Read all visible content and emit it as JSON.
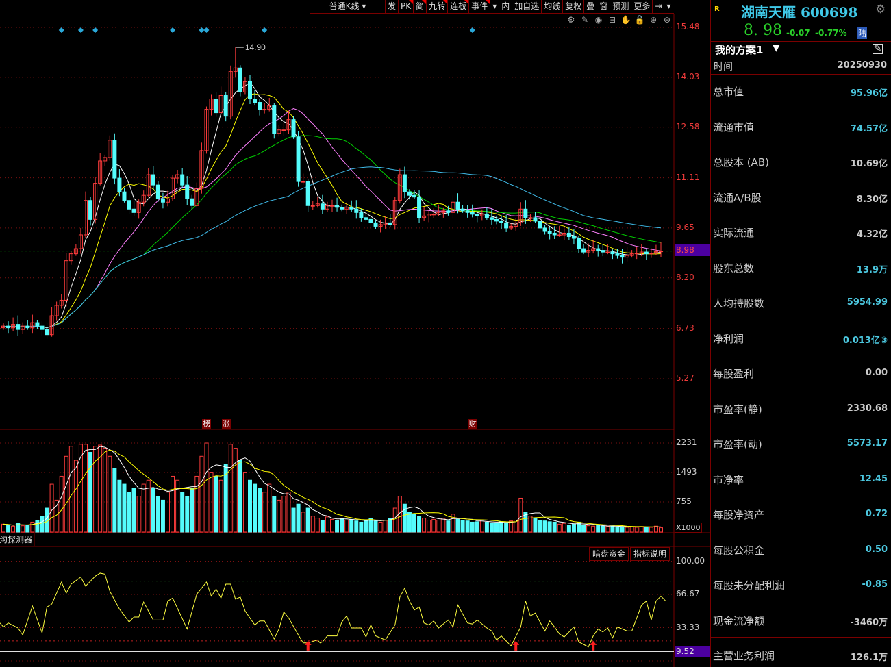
{
  "toolbar": {
    "items": [
      {
        "label": "普通K线 ▾",
        "flag": false
      },
      {
        "label": "发",
        "flag": false
      },
      {
        "label": "PK",
        "flag": true
      },
      {
        "label": "简",
        "flag": true
      },
      {
        "label": "九转",
        "flag": true
      },
      {
        "label": "连板",
        "flag": true
      },
      {
        "label": "事件",
        "flag": true
      },
      {
        "label": "▾",
        "flag": false
      },
      {
        "label": "内",
        "flag": false
      },
      {
        "label": "加自选",
        "flag": false
      },
      {
        "label": "均线",
        "flag": false
      },
      {
        "label": "复权",
        "flag": false
      },
      {
        "label": "叠",
        "flag": false
      },
      {
        "label": "窗",
        "flag": false
      },
      {
        "label": "预测",
        "flag": false
      },
      {
        "label": "更多",
        "flag": false
      },
      {
        "label": "⇥",
        "flag": false
      },
      {
        "label": "▾",
        "flag": false
      }
    ],
    "tools": [
      {
        "name": "settings-icon",
        "glyph": "⚙"
      },
      {
        "name": "pen-icon",
        "glyph": "✎"
      },
      {
        "name": "eye-icon",
        "glyph": "◉"
      },
      {
        "name": "basket-icon",
        "glyph": "⊟"
      },
      {
        "name": "hand-icon",
        "glyph": "✋"
      },
      {
        "name": "lock-icon",
        "glyph": "🔓"
      },
      {
        "name": "zoom-in-icon",
        "glyph": "⊕"
      },
      {
        "name": "zoom-out-icon",
        "glyph": "⊖"
      }
    ]
  },
  "price_axis": {
    "labels": [
      "15.48",
      "14.03",
      "12.58",
      "11.11",
      "9.65",
      "8.20",
      "6.73",
      "5.27"
    ],
    "max": 15.48,
    "min": 5.27,
    "current": "8.98",
    "current_value": 8.98,
    "high_label": "14.90",
    "high_value": 14.9
  },
  "colors": {
    "up": "#ff3c3c",
    "down": "#54fcfc",
    "ma5": "#ffffff",
    "ma10": "#ffff00",
    "ma20": "#ff80ff",
    "ma30": "#00d000",
    "ma60": "#40bcea",
    "grid": "#7a1010",
    "current_line": "#00c000",
    "osc": "#ffff40",
    "event_diamond": "#2aa8d8"
  },
  "ma_periods": [
    5,
    10,
    20,
    30,
    60
  ],
  "closes": [
    6.8,
    6.75,
    6.85,
    6.7,
    6.8,
    6.75,
    6.9,
    6.8,
    6.7,
    6.55,
    7.1,
    7.4,
    7.55,
    8.7,
    8.9,
    9.05,
    9.45,
    10.45,
    9.9,
    10.95,
    11.6,
    11.7,
    12.2,
    11.1,
    10.7,
    10.45,
    10.2,
    10.1,
    10.4,
    10.6,
    11.2,
    10.9,
    10.5,
    10.4,
    10.5,
    11.1,
    11.2,
    10.9,
    10.5,
    10.3,
    10.8,
    11.9,
    13.1,
    13.4,
    13.0,
    13.5,
    12.9,
    14.2,
    14.3,
    13.6,
    13.9,
    13.4,
    13.3,
    13.1,
    13.1,
    13.2,
    12.4,
    12.5,
    12.5,
    12.8,
    12.3,
    11.0,
    11.0,
    10.3,
    10.3,
    10.35,
    10.2,
    10.3,
    10.3,
    10.25,
    10.2,
    10.25,
    10.2,
    10.1,
    9.95,
    9.9,
    9.8,
    9.7,
    9.75,
    9.8,
    9.75,
    10.45,
    11.2,
    10.7,
    10.6,
    10.55,
    9.95,
    10.0,
    10.05,
    10.05,
    10.1,
    10.15,
    10.1,
    10.4,
    10.2,
    10.15,
    10.1,
    10.05,
    10.0,
    10.05,
    9.95,
    9.9,
    9.85,
    9.8,
    9.65,
    9.7,
    9.8,
    10.2,
    9.95,
    9.95,
    9.85,
    9.65,
    9.55,
    9.5,
    9.45,
    9.45,
    9.5,
    9.4,
    9.35,
    9.05,
    8.95,
    9.0,
    9.05,
    9.0,
    8.95,
    8.95,
    8.9,
    8.85,
    8.8,
    8.85,
    8.9,
    8.92,
    8.95,
    8.9,
    8.92,
    8.96,
    8.98
  ],
  "volumes": [
    200,
    180,
    150,
    220,
    160,
    180,
    250,
    300,
    400,
    600,
    1200,
    800,
    1400,
    1900,
    2150,
    1800,
    2200,
    2200,
    2000,
    2150,
    2180,
    2100,
    1900,
    1600,
    1300,
    1200,
    1000,
    1100,
    900,
    1200,
    1300,
    1100,
    900,
    800,
    1000,
    1400,
    1300,
    1000,
    900,
    1100,
    1400,
    1900,
    2231,
    1500,
    1400,
    1300,
    1700,
    2200,
    2100,
    1800,
    1500,
    1300,
    1200,
    1100,
    1000,
    1200,
    900,
    800,
    900,
    1000,
    600,
    700,
    500,
    600,
    400,
    350,
    300,
    380,
    320,
    300,
    350,
    300,
    320,
    280,
    250,
    300,
    350,
    280,
    250,
    300,
    350,
    600,
    900,
    700,
    500,
    450,
    400,
    350,
    300,
    320,
    300,
    350,
    280,
    450,
    320,
    300,
    280,
    250,
    260,
    300,
    250,
    230,
    220,
    260,
    240,
    280,
    300,
    850,
    500,
    400,
    350,
    300,
    280,
    260,
    250,
    200,
    220,
    180,
    200,
    250,
    180,
    160,
    150,
    170,
    150,
    140,
    150,
    130,
    140,
    120,
    130,
    120,
    140,
    130,
    120,
    150,
    110
  ],
  "event_diamond_bars": [
    12,
    16,
    19,
    35,
    41,
    42,
    54,
    97
  ],
  "events": [
    {
      "label": "榜",
      "bar": 42
    },
    {
      "label": "涨",
      "bar": 46
    },
    {
      "label": "财",
      "bar": 97
    }
  ],
  "volume_axis": {
    "labels": [
      "2231",
      "1493",
      "755"
    ],
    "values": [
      2231,
      1493,
      755
    ],
    "unit": "X1000"
  },
  "detector_label": "沟探测器",
  "indicator_buttons": [
    "暗盘资金",
    "指标说明"
  ],
  "osc_axis": {
    "labels": [
      "100.00",
      "66.67",
      "33.33"
    ],
    "values": [
      100,
      66.67,
      33.33
    ],
    "current": "9.52",
    "current_value": 9.52,
    "upper_ref": 80,
    "lower_ref": 20
  },
  "osc_points": [
    [
      -1,
      38
    ],
    [
      0,
      34
    ],
    [
      1,
      38
    ],
    [
      3,
      33
    ],
    [
      4,
      26
    ],
    [
      6,
      55
    ],
    [
      8,
      28
    ],
    [
      9,
      54
    ],
    [
      10,
      57
    ],
    [
      12,
      79
    ],
    [
      13,
      68
    ],
    [
      14,
      77
    ],
    [
      16,
      84
    ],
    [
      17,
      75
    ],
    [
      19,
      85
    ],
    [
      20,
      88
    ],
    [
      21,
      87
    ],
    [
      22,
      70
    ],
    [
      24,
      52
    ],
    [
      26,
      39
    ],
    [
      27,
      44
    ],
    [
      28,
      44
    ],
    [
      29,
      59
    ],
    [
      31,
      41
    ],
    [
      33,
      41
    ],
    [
      34,
      60
    ],
    [
      35,
      63
    ],
    [
      38,
      32
    ],
    [
      40,
      67
    ],
    [
      42,
      79
    ],
    [
      43,
      65
    ],
    [
      44,
      72
    ],
    [
      45,
      63
    ],
    [
      46,
      77
    ],
    [
      47,
      77
    ],
    [
      48,
      62
    ],
    [
      49,
      64
    ],
    [
      50,
      50
    ],
    [
      52,
      36
    ],
    [
      53,
      40
    ],
    [
      54,
      40
    ],
    [
      56,
      22
    ],
    [
      57,
      32
    ],
    [
      58,
      49
    ],
    [
      59,
      43
    ],
    [
      61,
      26
    ],
    [
      62,
      18
    ],
    [
      63,
      18
    ],
    [
      65,
      21
    ],
    [
      65.5,
      18
    ],
    [
      66,
      19
    ],
    [
      67,
      25
    ],
    [
      69,
      25
    ],
    [
      70,
      39
    ],
    [
      71,
      45
    ],
    [
      72,
      33
    ],
    [
      74,
      33
    ],
    [
      75,
      24
    ],
    [
      76,
      36
    ],
    [
      77,
      25
    ],
    [
      79,
      21
    ],
    [
      81,
      36
    ],
    [
      82,
      64
    ],
    [
      83,
      73
    ],
    [
      84,
      60
    ],
    [
      85,
      51
    ],
    [
      86,
      54
    ],
    [
      87,
      38
    ],
    [
      88,
      36
    ],
    [
      89,
      40
    ],
    [
      90,
      33
    ],
    [
      92,
      41
    ],
    [
      93,
      34
    ],
    [
      94,
      56
    ],
    [
      96,
      38
    ],
    [
      97,
      37
    ],
    [
      98,
      41
    ],
    [
      100,
      33
    ],
    [
      101,
      30
    ],
    [
      102,
      21
    ],
    [
      103,
      25
    ],
    [
      105,
      15
    ],
    [
      107,
      34
    ],
    [
      108,
      60
    ],
    [
      109,
      45
    ],
    [
      110,
      48
    ],
    [
      112,
      30
    ],
    [
      113,
      40
    ],
    [
      114,
      34
    ],
    [
      115,
      27
    ],
    [
      116,
      24
    ],
    [
      118,
      34
    ],
    [
      119,
      19
    ],
    [
      121,
      14
    ],
    [
      122,
      25
    ],
    [
      123,
      32
    ],
    [
      124,
      29
    ],
    [
      125,
      33
    ],
    [
      126,
      23
    ],
    [
      127,
      34
    ],
    [
      129,
      30
    ],
    [
      130,
      30
    ],
    [
      132,
      56
    ],
    [
      133,
      60
    ],
    [
      134,
      41
    ],
    [
      135,
      60
    ],
    [
      136,
      65
    ],
    [
      137,
      60
    ]
  ],
  "osc_signal_bars": [
    63,
    106,
    122
  ],
  "stock": {
    "badge": "R",
    "name": "湖南天雁 600698",
    "price": "8. 98",
    "change": "-0.07",
    "change_pct": "-0.77%",
    "market_tag": "陆"
  },
  "panel": {
    "plan": "我的方案1",
    "time_label": "时间",
    "time_value": "20250930",
    "rows": [
      {
        "label": "总市值",
        "value": "95.96亿",
        "color": "#4cc8e0"
      },
      {
        "label": "流通市值",
        "value": "74.57亿",
        "color": "#4cc8e0"
      },
      {
        "label": "总股本 (AB)",
        "value": "10.69亿",
        "color": "#cccccc"
      },
      {
        "label": "流通A/B股",
        "value": "8.30亿",
        "color": "#cccccc"
      },
      {
        "label": "实际流通",
        "value": "4.32亿",
        "color": "#cccccc"
      },
      {
        "label": "股东总数",
        "value": "13.9万",
        "color": "#4cc8e0"
      },
      {
        "label": "人均持股数",
        "value": "5954.99",
        "color": "#4cc8e0"
      },
      {
        "label": "净利润",
        "value": "0.013亿③",
        "color": "#4cc8e0"
      },
      {
        "label": "每股盈利",
        "value": "0.00",
        "color": "#cccccc"
      },
      {
        "label": "市盈率(静)",
        "value": "2330.68",
        "color": "#cccccc"
      },
      {
        "label": "市盈率(动)",
        "value": "5573.17",
        "color": "#4cc8e0"
      },
      {
        "label": "市净率",
        "value": "12.45",
        "color": "#4cc8e0"
      },
      {
        "label": "每股净资产",
        "value": "0.72",
        "color": "#4cc8e0"
      },
      {
        "label": "每股公积金",
        "value": "0.50",
        "color": "#4cc8e0"
      },
      {
        "label": "每股未分配利润",
        "value": "-0.85",
        "color": "#4cc8e0"
      },
      {
        "label": "现金流净额",
        "value": "-3460万",
        "color": "#cccccc"
      },
      {
        "label": "主营业务利润",
        "value": "126.1万",
        "color": "#cccccc"
      }
    ]
  }
}
